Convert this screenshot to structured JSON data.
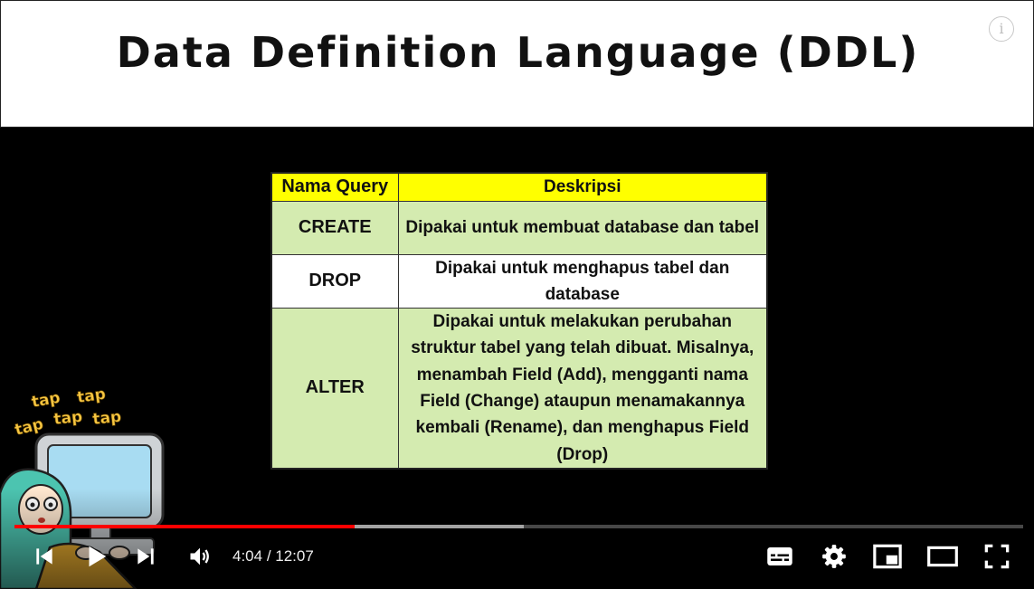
{
  "slide": {
    "title": "Data Definition Language (DDL)"
  },
  "table": {
    "headers": [
      "Nama Query",
      "Deskripsi"
    ],
    "rows": [
      {
        "name": "CREATE",
        "desc": "Dipakai untuk membuat database dan tabel"
      },
      {
        "name": "DROP",
        "desc": "Dipakai  untuk menghapus tabel dan database"
      },
      {
        "name": "ALTER",
        "desc": "Dipakai untuk melakukan perubahan struktur tabel yang telah dibuat. Misalnya, menambah Field (Add), mengganti nama Field (Change) ataupun menamakannya kembali (Rename), dan menghapus Field (Drop)"
      }
    ]
  },
  "mascot": {
    "caption_lines": [
      "tap",
      "tap",
      "tap",
      "tap",
      "tap"
    ]
  },
  "player": {
    "current_time": "4:04",
    "separator": " / ",
    "duration": "12:07",
    "played_fraction": 0.337,
    "buffered_fraction": 0.505,
    "accent_color": "#ff0000",
    "icons": {
      "info": "info-icon",
      "previous": "skip-previous-icon",
      "play": "play-icon",
      "next": "skip-next-icon",
      "volume": "volume-icon",
      "subtitles": "subtitles-icon",
      "settings": "settings-gear-icon",
      "miniplayer": "miniplayer-icon",
      "theater": "theater-mode-icon",
      "fullscreen": "fullscreen-icon"
    }
  }
}
